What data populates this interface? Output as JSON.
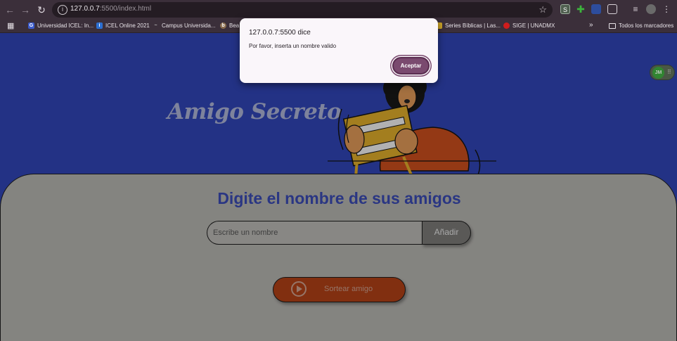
{
  "browser": {
    "url_host": "127.0.0.7",
    "url_rest": ":5500/index.html",
    "extensions": [
      "S"
    ],
    "bookmarks": [
      {
        "label": "Universidad ICEL: In...",
        "icon": "G",
        "color": "#3b5bcc"
      },
      {
        "label": "ICEL Online 2021",
        "icon": "i",
        "color": "#2c6fd1"
      },
      {
        "label": "Campus Universida...",
        "icon": "~",
        "color": "#777777"
      },
      {
        "label": "Bea",
        "icon": "b",
        "color": "#8a6d4f"
      },
      {
        "label": "Series Bíblicas | Las...",
        "icon": "",
        "color": "#c9a227"
      },
      {
        "label": "SIGE | UNADMX",
        "icon": "",
        "color": "#d01c1c"
      }
    ],
    "more_bookmarks": "»",
    "all_bookmarks": "Todos los marcadores"
  },
  "page": {
    "hero_title": "Amigo Secreto",
    "panel_title": "Digite el nombre de sus amigos",
    "input_placeholder": "Escribe un nombre",
    "add_button": "Añadir",
    "draw_button": "Sortear amigo",
    "avatar_initials": "JM",
    "colors": {
      "page_bg": "#2b3ea3",
      "panel_bg": "#a2a19d",
      "draw_btn": "#9e3a14",
      "title": "#3443a0"
    }
  },
  "dialog": {
    "title": "127.0.0.7:5500 dice",
    "message": "Por favor, inserta un nombre valido",
    "ok_button": "Aceptar"
  }
}
